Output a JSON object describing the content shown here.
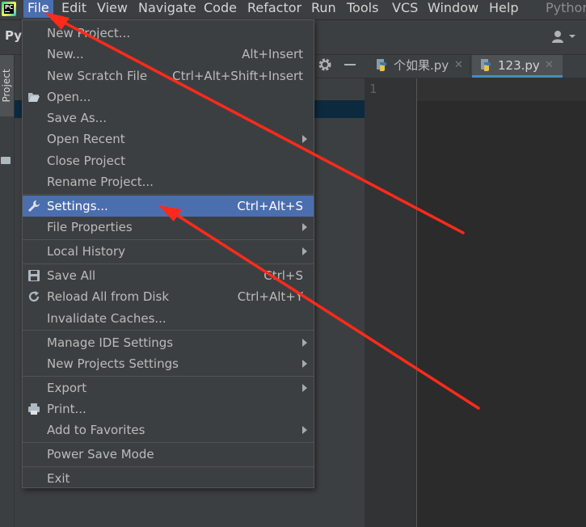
{
  "app": {
    "name_truncated": "Python",
    "project_name": "Py",
    "logo_text": "PC"
  },
  "menubar": {
    "items": [
      {
        "label": "File",
        "active": true
      },
      {
        "label": "Edit"
      },
      {
        "label": "View"
      },
      {
        "label": "Navigate"
      },
      {
        "label": "Code"
      },
      {
        "label": "Refactor"
      },
      {
        "label": "Run"
      },
      {
        "label": "Tools"
      },
      {
        "label": "VCS"
      },
      {
        "label": "Window"
      },
      {
        "label": "Help"
      }
    ]
  },
  "side_panel": {
    "tab_label": "Project"
  },
  "editor": {
    "tabs": [
      {
        "label": "个如果.py",
        "active": false
      },
      {
        "label": "123.py",
        "active": true
      }
    ],
    "line_numbers": [
      "1"
    ]
  },
  "file_menu": {
    "items": [
      {
        "label": "New Project...",
        "shortcut": ""
      },
      {
        "label": "New...",
        "shortcut": "Alt+Insert"
      },
      {
        "label": "New Scratch File",
        "shortcut": "Ctrl+Alt+Shift+Insert"
      },
      {
        "label": "Open...",
        "shortcut": "",
        "icon": "folder-open-icon"
      },
      {
        "label": "Save As...",
        "shortcut": ""
      },
      {
        "label": "Open Recent",
        "submenu": true
      },
      {
        "label": "Close Project",
        "shortcut": ""
      },
      {
        "label": "Rename Project...",
        "shortcut": ""
      },
      {
        "label": "Settings...",
        "shortcut": "Ctrl+Alt+S",
        "icon": "wrench-icon",
        "selected": true
      },
      {
        "label": "File Properties",
        "submenu": true
      },
      {
        "label": "Local History",
        "submenu": true
      },
      {
        "label": "Save All",
        "shortcut": "Ctrl+S",
        "icon": "save-icon"
      },
      {
        "label": "Reload All from Disk",
        "shortcut": "Ctrl+Alt+Y",
        "icon": "reload-icon"
      },
      {
        "label": "Invalidate Caches...",
        "shortcut": ""
      },
      {
        "label": "Manage IDE Settings",
        "submenu": true
      },
      {
        "label": "New Projects Settings",
        "submenu": true
      },
      {
        "label": "Export",
        "submenu": true
      },
      {
        "label": "Print...",
        "shortcut": "",
        "icon": "print-icon"
      },
      {
        "label": "Add to Favorites",
        "submenu": true
      },
      {
        "label": "Power Save Mode",
        "shortcut": ""
      },
      {
        "label": "Exit",
        "shortcut": ""
      }
    ]
  },
  "colors": {
    "menu_bg": "#3c3f41",
    "selection": "#4b6eaf",
    "editor_bg": "#2b2b2b",
    "annotation_arrow": "#ff2a1a"
  }
}
